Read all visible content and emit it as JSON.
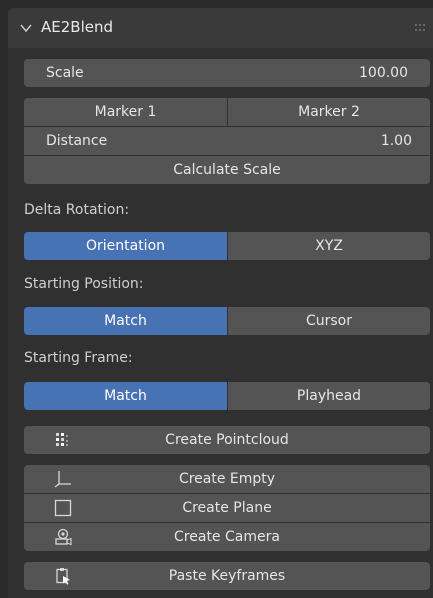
{
  "panel": {
    "title": "AE2Blend"
  },
  "scale": {
    "label": "Scale",
    "value": "100.00"
  },
  "markers": {
    "marker1": "Marker 1",
    "marker2": "Marker 2"
  },
  "distance": {
    "label": "Distance",
    "value": "1.00"
  },
  "calculate_scale": "Calculate Scale",
  "delta_rotation": {
    "label": "Delta Rotation:",
    "options": [
      "Orientation",
      "XYZ"
    ],
    "selected": "Orientation"
  },
  "starting_position": {
    "label": "Starting Position:",
    "options": [
      "Match",
      "Cursor"
    ],
    "selected": "Match"
  },
  "starting_frame": {
    "label": "Starting Frame:",
    "options": [
      "Match",
      "Playhead"
    ],
    "selected": "Match"
  },
  "create_pointcloud": "Create Pointcloud",
  "create_empty": "Create Empty",
  "create_plane": "Create Plane",
  "create_camera": "Create Camera",
  "paste_keyframes": "Paste Keyframes",
  "colors": {
    "panel_bg": "#303030",
    "header_bg": "#3a3a3a",
    "button_bg": "#545454",
    "accent": "#4772b3",
    "text": "#e6e6e6"
  }
}
